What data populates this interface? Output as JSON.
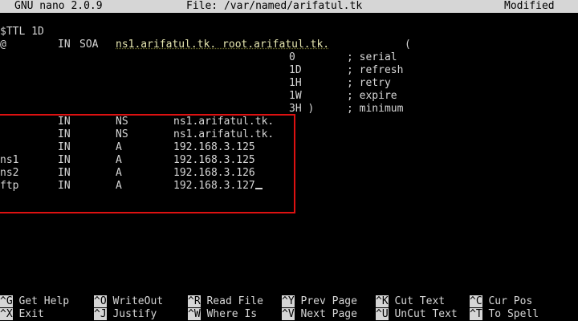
{
  "titlebar": {
    "app": "GNU nano 2.0.9",
    "file": "File: /var/named/arifatul.tk",
    "status": "Modified"
  },
  "zone": {
    "ttl_line": "$TTL 1D",
    "soa": {
      "owner": "@",
      "class": "IN",
      "type": "SOA",
      "mname_rname": "ns1.arifatul.tk. root.arifatul.tk.",
      "open_paren": "("
    },
    "soa_params": [
      {
        "value": "0",
        "comment": "; serial"
      },
      {
        "value": "1D",
        "comment": "; refresh"
      },
      {
        "value": "1H",
        "comment": "; retry"
      },
      {
        "value": "1W",
        "comment": "; expire"
      },
      {
        "value": "3H )",
        "comment": "; minimum"
      }
    ],
    "records": [
      {
        "name": "",
        "class": "IN",
        "type": "NS",
        "data": "ns1.arifatul.tk."
      },
      {
        "name": "",
        "class": "IN",
        "type": "NS",
        "data": "ns1.arifatul.tk."
      },
      {
        "name": "",
        "class": "IN",
        "type": "A",
        "data": "192.168.3.125"
      },
      {
        "name": "ns1",
        "class": "IN",
        "type": "A",
        "data": "192.168.3.125"
      },
      {
        "name": "ns2",
        "class": "IN",
        "type": "A",
        "data": "192.168.3.126"
      },
      {
        "name": "ftp",
        "class": "IN",
        "type": "A",
        "data": "192.168.3.127"
      }
    ]
  },
  "shortcuts": {
    "row1": [
      {
        "key": "^G",
        "label": "Get Help"
      },
      {
        "key": "^O",
        "label": "WriteOut"
      },
      {
        "key": "^R",
        "label": "Read File"
      },
      {
        "key": "^Y",
        "label": "Prev Page"
      },
      {
        "key": "^K",
        "label": "Cut Text"
      },
      {
        "key": "^C",
        "label": "Cur Pos"
      }
    ],
    "row2": [
      {
        "key": "^X",
        "label": "Exit"
      },
      {
        "key": "^J",
        "label": "Justify"
      },
      {
        "key": "^W",
        "label": "Where Is"
      },
      {
        "key": "^V",
        "label": "Next Page"
      },
      {
        "key": "^U",
        "label": "UnCut Text"
      },
      {
        "key": "^T",
        "label": "To Spell"
      }
    ]
  }
}
